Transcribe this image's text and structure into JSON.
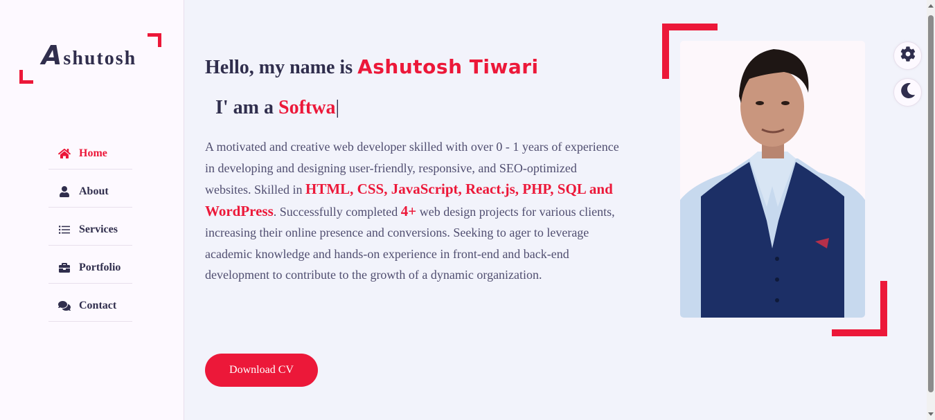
{
  "logo": {
    "first_letter": "A",
    "rest": "shutosh"
  },
  "nav": {
    "items": [
      {
        "label": "Home",
        "icon": "home-icon",
        "active": true
      },
      {
        "label": "About",
        "icon": "user-icon",
        "active": false
      },
      {
        "label": "Services",
        "icon": "list-icon",
        "active": false
      },
      {
        "label": "Portfolio",
        "icon": "briefcase-icon",
        "active": false
      },
      {
        "label": "Contact",
        "icon": "comments-icon",
        "active": false
      }
    ]
  },
  "hero": {
    "greeting_prefix": "Hello, my name is",
    "name": "Ashutosh Tiwari",
    "role_prefix": "I' am a",
    "role_typed": "Softwa",
    "cursor": "|",
    "desc_part1": "A motivated and creative web developer skilled with over 0 - 1 years of experience in developing and designing user-friendly, responsive, and SEO-optimized websites. Skilled in ",
    "desc_skills": "HTML, CSS, JavaScript, React.js, PHP, SQL and WordPress",
    "desc_part2": ". Successfully completed ",
    "desc_projects": "4+",
    "desc_part3": " web design projects for various clients, increasing their online presence and conversions. Seeking to ager to leverage academic knowledge and hands-on experience in front-end and back-end development to contribute to the growth of a dynamic organization.",
    "download_label": "Download CV"
  },
  "switcher": {
    "settings_icon": "gear-icon",
    "theme_icon": "moon-icon"
  },
  "colors": {
    "accent": "#ec1839",
    "text": "#302e4d",
    "sidebar_bg": "#fdf9ff",
    "page_bg": "#f2f3fb"
  }
}
